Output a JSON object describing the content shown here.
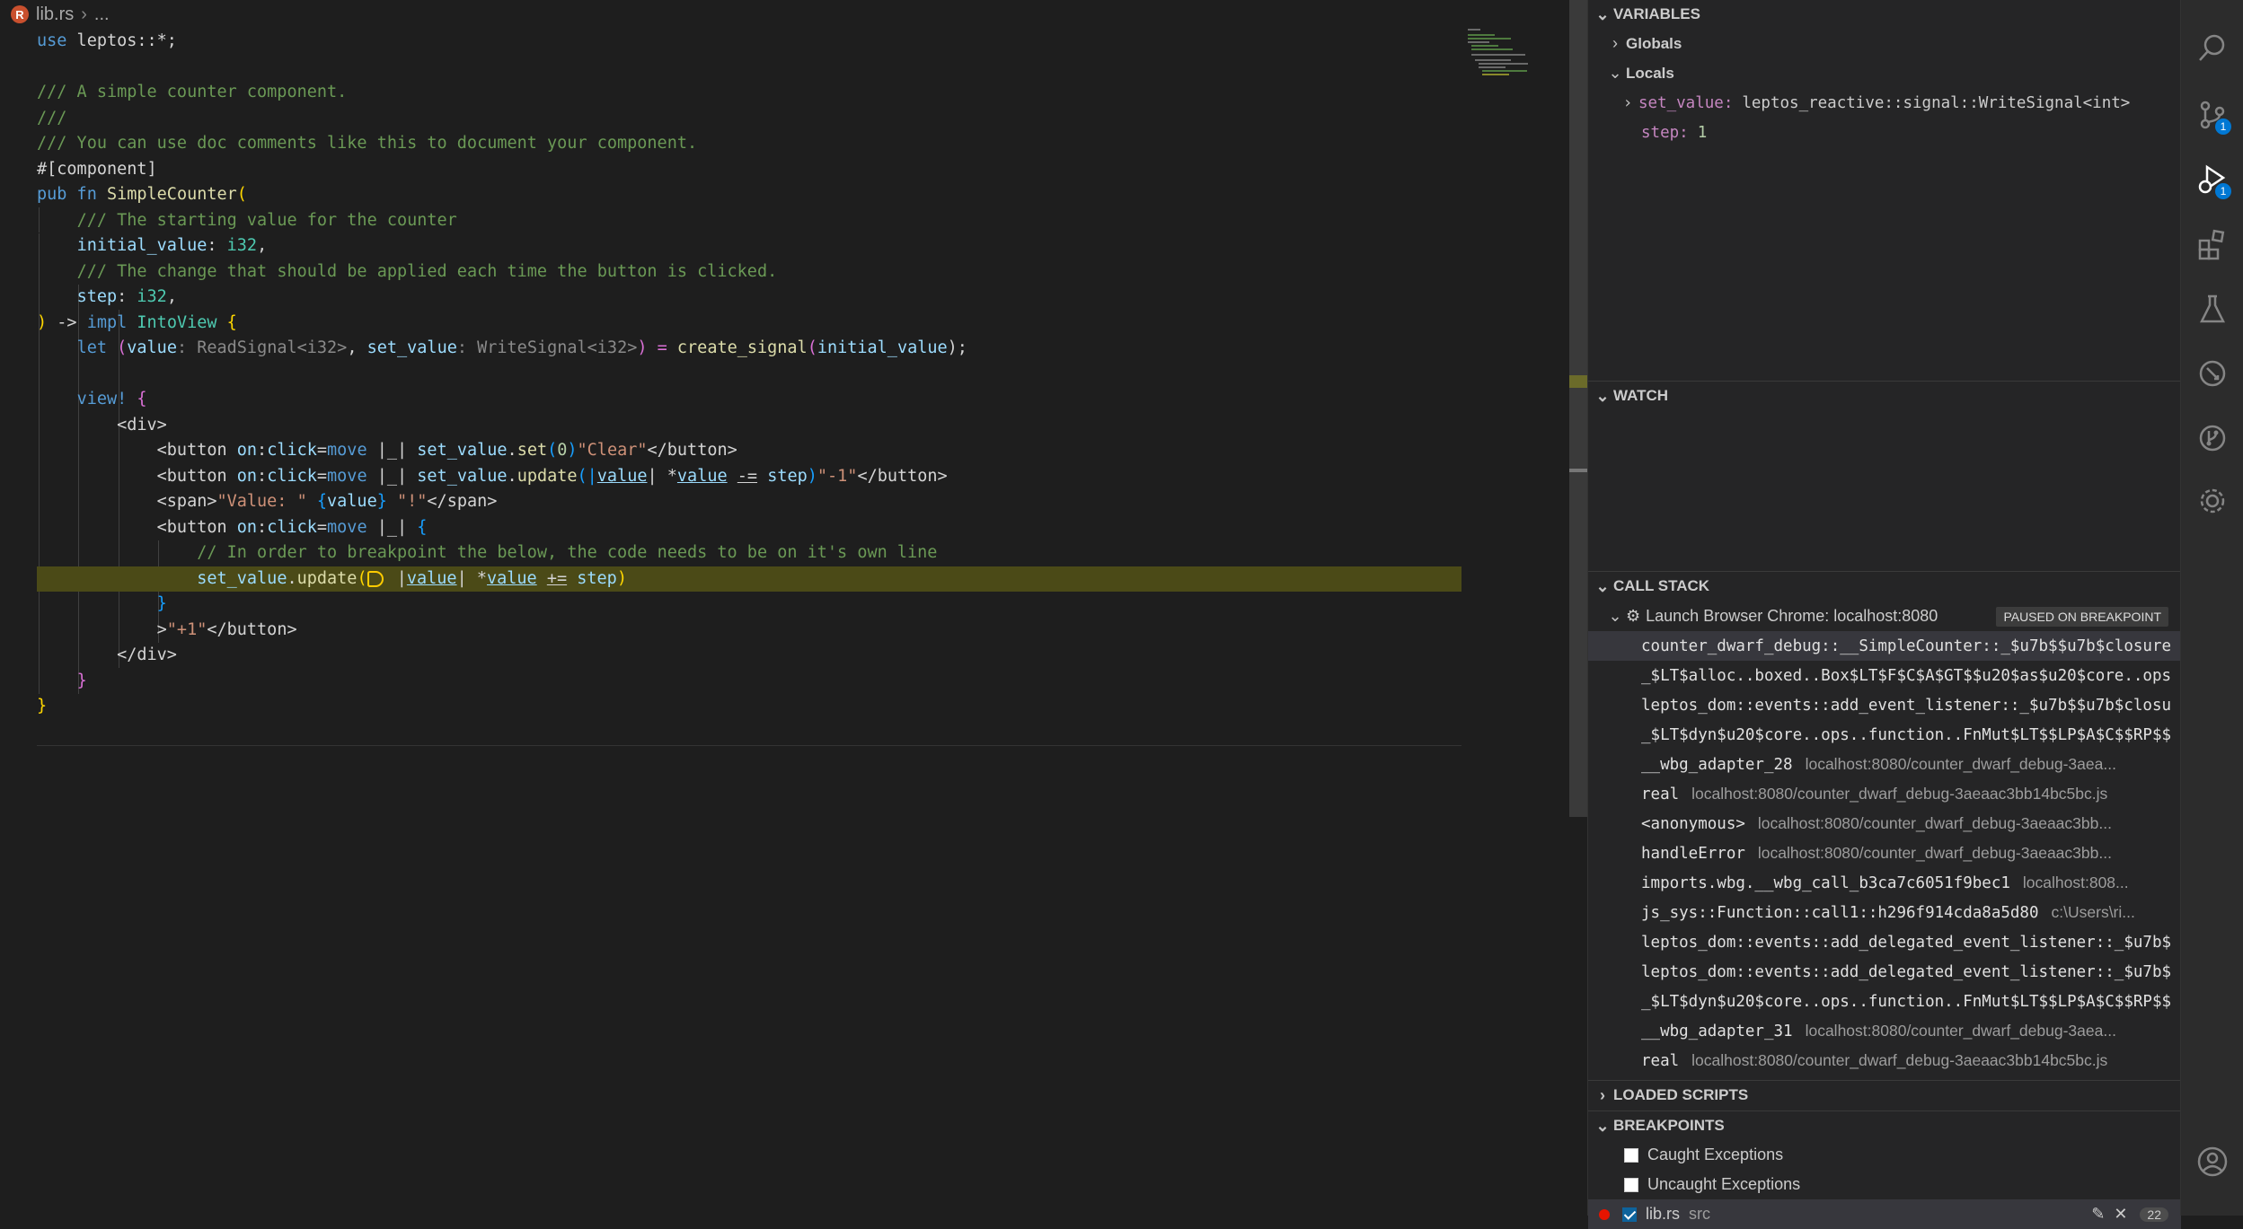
{
  "breadcrumb": {
    "badge": "R",
    "file": "lib.rs",
    "rest": "..."
  },
  "code": {
    "l1_a": "use",
    "l1_b": " leptos::*;",
    "l3": "/// A simple counter component.",
    "l4": "///",
    "l5": "/// You can use doc comments like this to document your component.",
    "l6": "#[component]",
    "l7_a": "pub",
    "l7_b": " fn ",
    "l7_c": "SimpleCounter",
    "l7_d": "(",
    "l8": "/// The starting value for the counter",
    "l9_a": "initial_value",
    "l9_b": ": ",
    "l9_c": "i32",
    "l9_d": ",",
    "l10": "/// The change that should be applied each time the button is clicked.",
    "l11_a": "step",
    "l11_b": ": ",
    "l11_c": "i32",
    "l11_d": ",",
    "l12_a": ")",
    "l12_b": " -> ",
    "l12_c": "impl",
    "l12_d": " ",
    "l12_e": "IntoView",
    "l12_f": " {",
    "l13_a": "let",
    "l13_b": " (",
    "l13_c": "value",
    "l13_d": ": ReadSignal<i32>",
    "l13_e": ", ",
    "l13_f": "set_value",
    "l13_g": ": WriteSignal<i32>",
    "l13_h": ") = ",
    "l13_i": "create_signal",
    "l13_j": "(",
    "l13_k": "initial_value",
    "l13_l": ");",
    "l15_a": "view!",
    "l15_b": " {",
    "l16": "<div>",
    "l17_a": "<button ",
    "l17_b": "on",
    "l17_c": ":",
    "l17_d": "click",
    "l17_e": "=",
    "l17_f": "move",
    "l17_g": " |_| ",
    "l17_h": "set_value",
    "l17_i": ".",
    "l17_j": "set",
    "l17_k": "(",
    "l17_l": "0",
    "l17_m": ")",
    "l17_n": "\"Clear\"",
    "l17_o": "</button>",
    "l18_a": "<button ",
    "l18_b": "on",
    "l18_c": ":",
    "l18_d": "click",
    "l18_e": "=",
    "l18_f": "move",
    "l18_g": " |_| ",
    "l18_h": "set_value",
    "l18_i": ".",
    "l18_j": "update",
    "l18_k": "(|",
    "l18_l": "value",
    "l18_m": "| *",
    "l18_n": "value",
    "l18_o": " ",
    "l18_p": "-=",
    "l18_q": " ",
    "l18_r": "step",
    "l18_s": ")",
    "l18_t": "\"-1\"",
    "l18_u": "</button>",
    "l19_a": "<span>",
    "l19_b": "\"Value: \"",
    "l19_c": " {",
    "l19_d": "value",
    "l19_e": "} ",
    "l19_f": "\"!\"",
    "l19_g": "</span>",
    "l20_a": "<button ",
    "l20_b": "on",
    "l20_c": ":",
    "l20_d": "click",
    "l20_e": "=",
    "l20_f": "move",
    "l20_g": " |_| ",
    "l20_h": "{",
    "l21": "// In order to breakpoint the below, the code needs to be on it's own line",
    "l22_a": "set_value",
    "l22_b": ".",
    "l22_c": "update",
    "l22_d": "(",
    "l22_e": " |",
    "l22_f": "value",
    "l22_g": "| *",
    "l22_h": "value",
    "l22_i": " ",
    "l22_j": "+=",
    "l22_k": " ",
    "l22_l": "step",
    "l22_m": ")",
    "l23": "}",
    "l24_a": ">",
    "l24_b": "\"+1\"",
    "l24_c": "</button>",
    "l25": "</div>",
    "l26": "}",
    "l27": "}"
  },
  "variables": {
    "title": "VARIABLES",
    "globals": "Globals",
    "locals": "Locals",
    "set_value_name": "set_value:",
    "set_value_type": "leptos_reactive::signal::WriteSignal<int>",
    "step_name": "step:",
    "step_value": "1"
  },
  "watch": {
    "title": "WATCH"
  },
  "callstack": {
    "title": "CALL STACK",
    "session": "Launch Browser Chrome: localhost:8080",
    "status": "PAUSED ON BREAKPOINT",
    "frames": [
      {
        "fn": "counter_dwarf_debug::__SimpleCounter::_$u7b$$u7b$closure",
        "src": ""
      },
      {
        "fn": "_$LT$alloc..boxed..Box$LT$F$C$A$GT$$u20$as$u20$core..ops",
        "src": ""
      },
      {
        "fn": "leptos_dom::events::add_event_listener::_$u7b$$u7b$closu",
        "src": ""
      },
      {
        "fn": "_$LT$dyn$u20$core..ops..function..FnMut$LT$$LP$A$C$$RP$$",
        "src": ""
      },
      {
        "fn": "__wbg_adapter_28",
        "src": "localhost:8080/counter_dwarf_debug-3aea..."
      },
      {
        "fn": "real",
        "src": "localhost:8080/counter_dwarf_debug-3aeaac3bb14bc5bc.js"
      },
      {
        "fn": "<anonymous>",
        "src": "localhost:8080/counter_dwarf_debug-3aeaac3bb..."
      },
      {
        "fn": "handleError",
        "src": "localhost:8080/counter_dwarf_debug-3aeaac3bb..."
      },
      {
        "fn": "imports.wbg.__wbg_call_b3ca7c6051f9bec1",
        "src": "localhost:808..."
      },
      {
        "fn": "js_sys::Function::call1::h296f914cda8a5d80",
        "src": "c:\\Users\\ri..."
      },
      {
        "fn": "leptos_dom::events::add_delegated_event_listener::_$u7b$",
        "src": ""
      },
      {
        "fn": "leptos_dom::events::add_delegated_event_listener::_$u7b$",
        "src": ""
      },
      {
        "fn": "_$LT$dyn$u20$core..ops..function..FnMut$LT$$LP$A$C$$RP$$",
        "src": ""
      },
      {
        "fn": "__wbg_adapter_31",
        "src": "localhost:8080/counter_dwarf_debug-3aea..."
      },
      {
        "fn": "real",
        "src": "localhost:8080/counter_dwarf_debug-3aeaac3bb14bc5bc.js"
      }
    ]
  },
  "loaded_scripts": {
    "title": "LOADED SCRIPTS"
  },
  "breakpoints": {
    "title": "BREAKPOINTS",
    "caught": "Caught Exceptions",
    "uncaught": "Uncaught Exceptions",
    "file": "lib.rs",
    "dir": "src",
    "count": "22"
  },
  "activity": {
    "scm_badge": "1",
    "debug_badge": "1"
  },
  "colors": {
    "accent": "#0078d4",
    "breakpoint_line": "#4b4a17",
    "editor_bg": "#1e1e1e",
    "sidebar_bg": "#252526"
  }
}
